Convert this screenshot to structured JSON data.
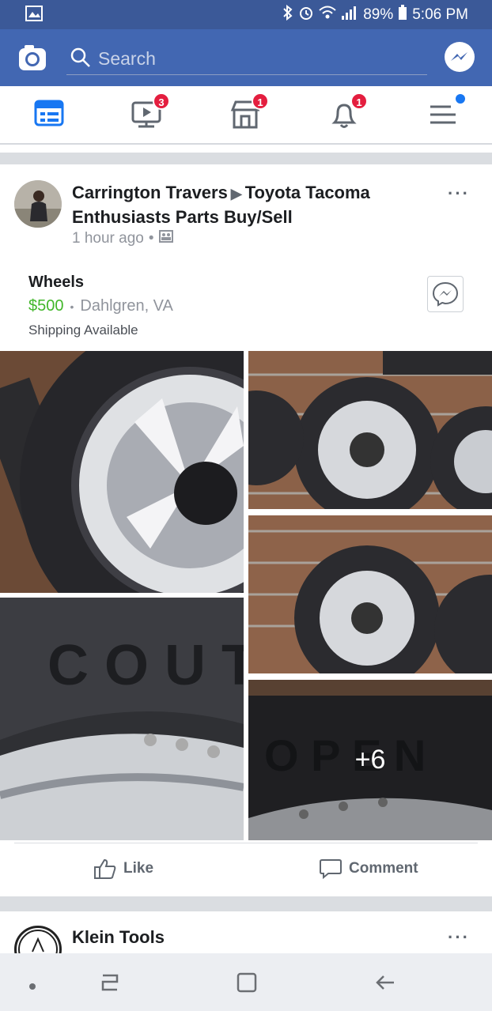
{
  "status_bar": {
    "battery": "89%",
    "time": "5:06 PM"
  },
  "header": {
    "search_placeholder": "Search"
  },
  "tabs": {
    "watch_badge": "3",
    "marketplace_badge": "1",
    "notifications_badge": "1"
  },
  "post": {
    "author": "Carrington Travers",
    "group": "Toyota Tacoma Enthusiasts Parts Buy/Sell",
    "time": "1 hour ago",
    "more_label": "···",
    "item_title": "Wheels",
    "price": "$500",
    "location": "Dahlgren, VA",
    "shipping": "Shipping Available",
    "more_photos": "+6",
    "like_label": "Like",
    "comment_label": "Comment"
  },
  "next_post": {
    "author": "Klein Tools",
    "more_label": "···"
  },
  "colors": {
    "brand": "#4267b2",
    "price": "#42b72a",
    "badge": "#e41e3f"
  }
}
